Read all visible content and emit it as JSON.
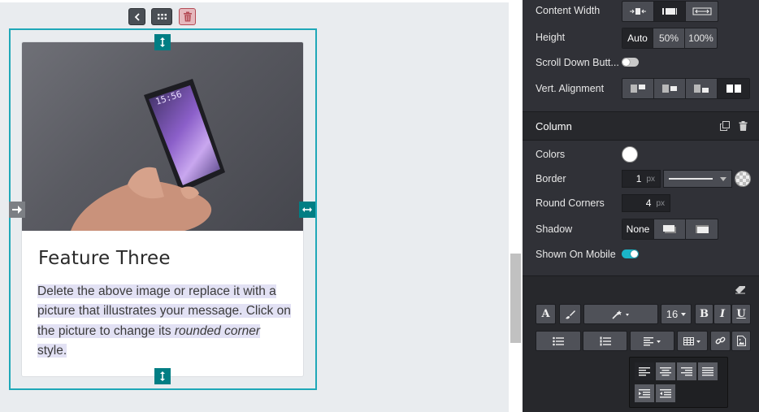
{
  "canvas": {
    "card": {
      "title": "Feature Three",
      "text_part1": "Delete the above image or replace it with a picture that illustrates your message. Click on the picture to change its ",
      "text_italic": "rounded corner",
      "text_part2": " style."
    },
    "phone_clock": "15:56"
  },
  "panel": {
    "content_width_label": "Content Width",
    "height_label": "Height",
    "height_options": [
      "Auto",
      "50%",
      "100%"
    ],
    "scroll_down_label": "Scroll Down Butt...",
    "vert_alignment_label": "Vert. Alignment",
    "column_title": "Column",
    "colors_label": "Colors",
    "border_label": "Border",
    "border_value": "1",
    "border_unit": "px",
    "round_corners_label": "Round Corners",
    "round_corners_value": "4",
    "round_corners_unit": "px",
    "shadow_label": "Shadow",
    "shadow_option": "None",
    "shown_mobile_label": "Shown On Mobile",
    "font_size": "16",
    "bold": "B",
    "italic": "I",
    "underline": "U",
    "font_letter": "A"
  },
  "colors": {
    "selection": "#1fa8b8",
    "handle": "#017e84",
    "toggle_on": "#1bb5c8"
  }
}
